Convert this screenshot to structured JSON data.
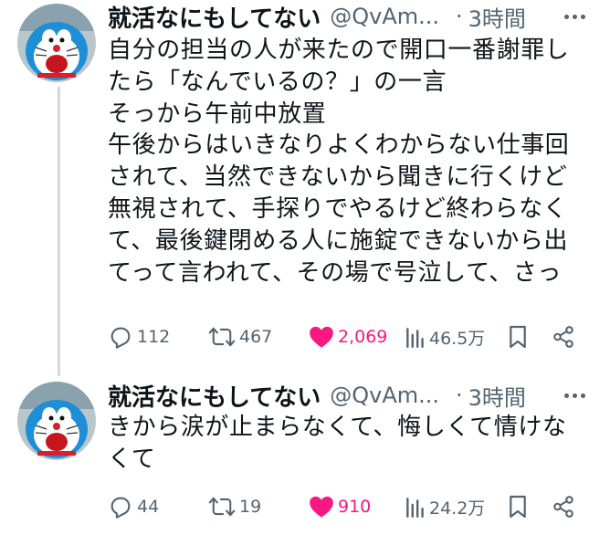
{
  "tweets": [
    {
      "display_name": "就活なにもしてない",
      "handle": "@QvAm...",
      "separator": "·",
      "time": "3時間",
      "text": "自分の担当の人が来たので開口一番謝罪し\nたら「なんでいるの？」の一言\nそっから午前中放置\n午後からはいきなりよくわからない仕事回\nされて、当然できないから聞きに行くけど\n無視されて、手探りでやるけど終わらなく\nて、最後鍵閉める人に施錠できないから出\nてって言われて、その場で号泣して、さっ",
      "replies": "112",
      "retweets": "467",
      "likes": "2,069",
      "views": "46.5万"
    },
    {
      "display_name": "就活なにもしてない",
      "handle": "@QvAm...",
      "separator": "·",
      "time": "3時間",
      "text": "きから涙が止まらなくて、悔しくて情けな\nくて",
      "replies": "44",
      "retweets": "19",
      "likes": "910",
      "views": "24.2万"
    }
  ],
  "colors": {
    "like_active": "#f91880",
    "secondary_text": "#536471",
    "thread_line": "#cfd9de"
  },
  "icons": [
    "avatar-image",
    "more-icon",
    "reply-icon",
    "retweet-icon",
    "like-icon",
    "views-icon",
    "bookmark-icon",
    "share-icon"
  ]
}
